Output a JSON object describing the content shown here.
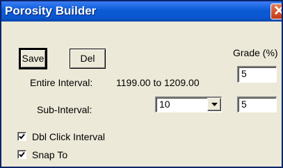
{
  "window": {
    "title": "Porosity Builder",
    "close_glyph": "✕"
  },
  "buttons": {
    "save_label": "Save",
    "del_label": "Del"
  },
  "grade": {
    "header": "Grade (%)",
    "entire_value": "5",
    "sub_value": "5"
  },
  "entire_interval": {
    "label": "Entire Interval:",
    "value": "1199.00 to 1209.00"
  },
  "sub_interval": {
    "label": "Sub-Interval:",
    "selected": "10"
  },
  "options": {
    "dbl_click": {
      "label": "Dbl Click Interval",
      "checked": true
    },
    "snap_to": {
      "label": "Snap To",
      "checked": true
    }
  },
  "colors": {
    "titlebar": "#0a5bd6",
    "close_button": "#d4542c",
    "dialog_bg": "#ece9d8"
  }
}
